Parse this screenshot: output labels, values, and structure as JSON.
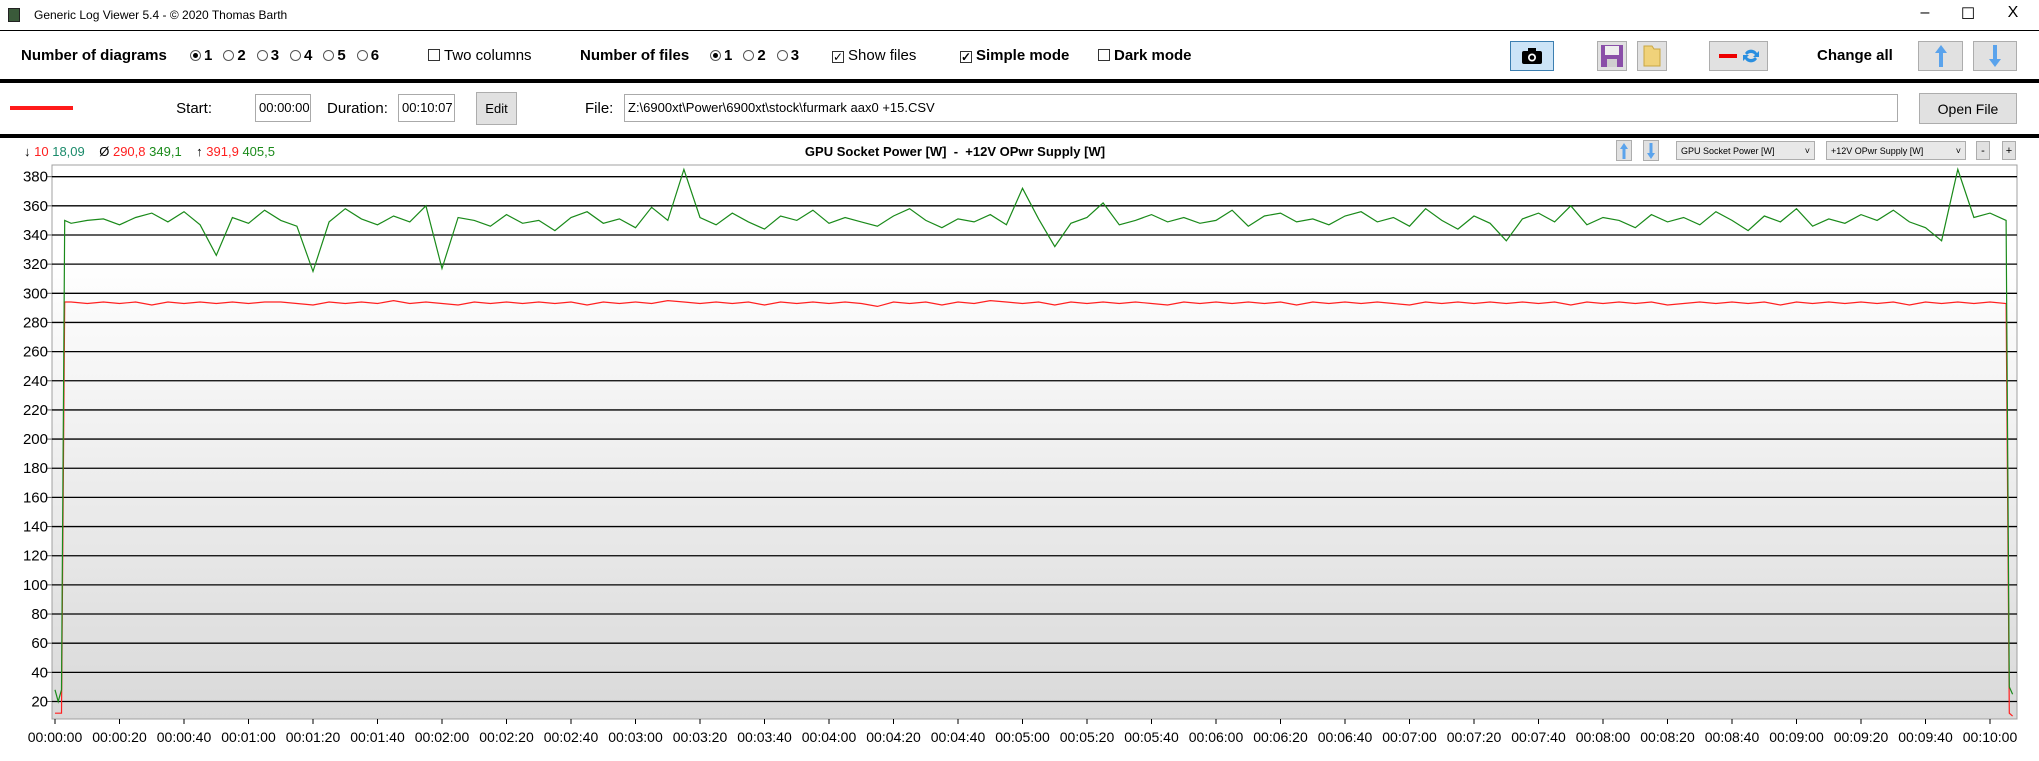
{
  "window": {
    "title": "Generic Log Viewer 5.4 - © 2020 Thomas Barth",
    "minimize": "–",
    "maximize": "☐",
    "close": "X"
  },
  "toolbar": {
    "num_diagrams_label": "Number of diagrams",
    "diagram_options": [
      "1",
      "2",
      "3",
      "4",
      "5",
      "6"
    ],
    "diagram_selected": "1",
    "two_columns": "Two columns",
    "num_files_label": "Number of files",
    "file_options": [
      "1",
      "2",
      "3"
    ],
    "file_selected": "1",
    "show_files": "Show files",
    "simple_mode": "Simple mode",
    "dark_mode": "Dark mode",
    "change_all": "Change all",
    "checked_mark": "✓"
  },
  "file_row": {
    "start_label": "Start:",
    "start_value": "00:00:00",
    "duration_label": "Duration:",
    "duration_value": "00:10:07",
    "edit": "Edit",
    "file_label": "File:",
    "file_path": "Z:\\6900xt\\Power\\6900xt\\stock\\furmark aax0 +15.CSV",
    "open_file": "Open File",
    "line_color": "#ff1a1a"
  },
  "chart_header": {
    "min_symbol": "↓",
    "min_a": "10",
    "min_b": "18,09",
    "avg_symbol": "Ø",
    "avg_a": "290,8",
    "avg_b": "349,1",
    "max_symbol": "↑",
    "max_a": "391,9",
    "max_b": "405,5",
    "title": "GPU Socket Power [W]  -  +12V OPwr Supply [W]",
    "select1": "GPU Socket Power [W]",
    "select2": "+12V OPwr Supply [W]",
    "minus": "-",
    "plus": "+",
    "chevron": "˅"
  },
  "chart_data": {
    "type": "line",
    "title": "GPU Socket Power [W]  -  +12V OPwr Supply [W]",
    "ylim": [
      8,
      388
    ],
    "xlim_seconds": [
      0,
      607
    ],
    "yticks": [
      20,
      40,
      60,
      80,
      100,
      120,
      140,
      160,
      180,
      200,
      220,
      240,
      260,
      280,
      300,
      320,
      340,
      360,
      380
    ],
    "xticks_seconds": [
      0,
      20,
      40,
      60,
      80,
      100,
      120,
      140,
      160,
      180,
      200,
      220,
      240,
      260,
      280,
      300,
      320,
      340,
      360,
      380,
      400,
      420,
      440,
      460,
      480,
      500,
      520,
      540,
      560,
      580,
      600
    ],
    "xtick_labels": [
      "00:00:00",
      "00:00:20",
      "00:00:40",
      "00:01:00",
      "00:01:20",
      "00:01:40",
      "00:02:00",
      "00:02:20",
      "00:02:40",
      "00:03:00",
      "00:03:20",
      "00:03:40",
      "00:04:00",
      "00:04:20",
      "00:04:40",
      "00:05:00",
      "00:05:20",
      "00:05:40",
      "00:06:00",
      "00:06:20",
      "00:06:40",
      "00:07:00",
      "00:07:20",
      "00:07:40",
      "00:08:00",
      "00:08:20",
      "00:08:40",
      "00:09:00",
      "00:09:20",
      "00:09:40",
      "00:10:00"
    ],
    "grid": true,
    "sample_interval_seconds": 5,
    "series": [
      {
        "name": "GPU Socket Power [W]",
        "color": "#ff2020",
        "start": [
          [
            0,
            12
          ],
          [
            2,
            12
          ],
          [
            3,
            294
          ]
        ],
        "values": [
          294,
          293,
          294,
          293,
          294,
          292,
          294,
          293,
          294,
          293,
          294,
          293,
          294,
          294,
          293,
          292,
          294,
          293,
          294,
          293,
          295,
          293,
          294,
          293,
          292,
          294,
          293,
          294,
          293,
          294,
          293,
          294,
          292,
          294,
          293,
          294,
          293,
          295,
          294,
          293,
          294,
          293,
          294,
          292,
          294,
          293,
          294,
          293,
          294,
          293,
          291,
          294,
          293,
          294,
          292,
          294,
          293,
          295,
          294,
          293,
          294,
          292,
          294,
          293,
          294,
          293,
          294,
          293,
          292,
          294,
          293,
          294,
          293,
          294,
          293,
          294,
          292,
          294,
          293,
          294,
          293,
          294,
          293,
          292,
          294,
          293,
          294,
          293,
          294,
          293,
          294,
          293,
          294,
          292,
          294,
          293,
          294,
          293,
          294,
          292,
          293,
          294,
          293,
          294,
          293,
          294,
          292,
          294,
          293,
          294,
          293,
          294,
          293,
          294,
          292,
          294,
          293,
          294,
          293,
          294,
          293
        ],
        "end": [
          [
            606,
            12
          ],
          [
            607,
            10
          ]
        ]
      },
      {
        "name": "+12V OPwr Supply [W]",
        "color": "#1a8a1a",
        "start": [
          [
            0,
            28
          ],
          [
            1,
            20
          ],
          [
            2,
            28
          ],
          [
            3,
            350
          ]
        ],
        "values": [
          348,
          350,
          351,
          347,
          352,
          355,
          349,
          356,
          347,
          326,
          352,
          348,
          357,
          350,
          346,
          315,
          349,
          358,
          351,
          347,
          353,
          349,
          360,
          317,
          352,
          350,
          346,
          354,
          348,
          350,
          343,
          352,
          356,
          348,
          351,
          345,
          359,
          350,
          385,
          352,
          347,
          355,
          349,
          344,
          353,
          350,
          357,
          348,
          352,
          349,
          346,
          353,
          358,
          350,
          345,
          351,
          349,
          354,
          347,
          372,
          351,
          332,
          348,
          352,
          362,
          347,
          350,
          354,
          349,
          352,
          348,
          350,
          357,
          346,
          353,
          355,
          349,
          351,
          347,
          353,
          356,
          349,
          352,
          346,
          358,
          350,
          344,
          353,
          348,
          336,
          351,
          355,
          349,
          360,
          347,
          352,
          350,
          345,
          354,
          349,
          352,
          347,
          356,
          350,
          343,
          353,
          349,
          358,
          346,
          351,
          348,
          354,
          350,
          357,
          349,
          345,
          336,
          385,
          352,
          355,
          350
        ],
        "end": [
          [
            606,
            30
          ],
          [
            607,
            25
          ]
        ]
      }
    ]
  }
}
